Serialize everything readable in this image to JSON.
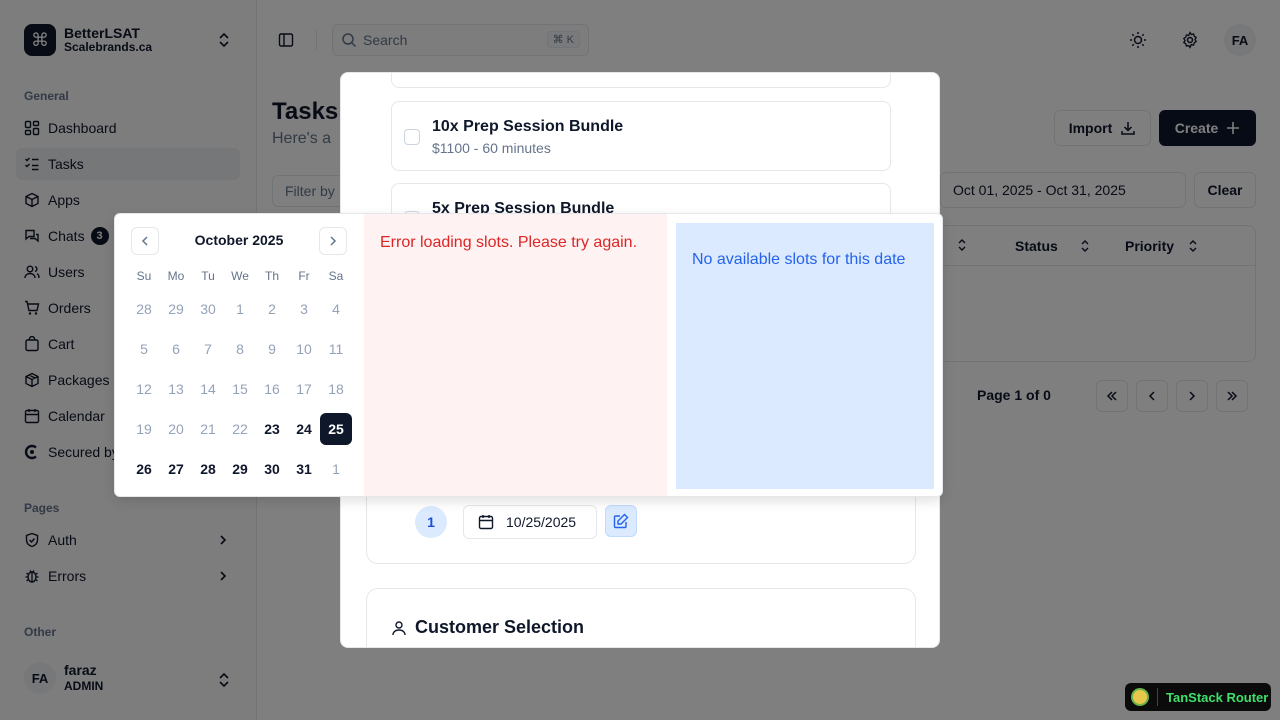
{
  "brand": {
    "name": "BetterLSAT",
    "subtitle": "Scalebrands.ca"
  },
  "sidebar": {
    "general_label": "General",
    "general_items": [
      {
        "label": "Dashboard",
        "icon": "dashboard-icon"
      },
      {
        "label": "Tasks",
        "icon": "tasks-icon",
        "active": true
      },
      {
        "label": "Apps",
        "icon": "apps-icon"
      },
      {
        "label": "Chats",
        "icon": "chats-icon",
        "badge": "3"
      },
      {
        "label": "Users",
        "icon": "users-icon"
      },
      {
        "label": "Orders",
        "icon": "cart-icon"
      },
      {
        "label": "Cart",
        "icon": "cart-icon"
      },
      {
        "label": "Packages",
        "icon": "package-icon"
      },
      {
        "label": "Calendar",
        "icon": "calendar-icon"
      },
      {
        "label": "Secured by",
        "icon": "clerk-icon"
      }
    ],
    "pages_label": "Pages",
    "pages_items": [
      {
        "label": "Auth",
        "icon": "shield-icon"
      },
      {
        "label": "Errors",
        "icon": "bug-icon"
      }
    ],
    "other_label": "Other",
    "user": {
      "initials": "FA",
      "name": "faraz",
      "role": "ADMIN"
    }
  },
  "header": {
    "search_placeholder": "Search",
    "search_shortcut": "⌘ K",
    "avatar_initials": "FA"
  },
  "page": {
    "title": "Tasks",
    "subtitle": "Here's a",
    "import_label": "Import",
    "create_label": "Create",
    "filter_placeholder": "Filter by",
    "date_range": "Oct 01, 2025 - Oct 31, 2025",
    "clear_label": "Clear",
    "columns": [
      "Status",
      "Priority"
    ],
    "pager_text": "Page 1 of 0"
  },
  "modal": {
    "packages": [
      {
        "name": "10x Prep Session Bundle",
        "meta": "$1100 - 60 minutes"
      },
      {
        "name": "5x Prep Session Bundle",
        "meta": ""
      }
    ],
    "session_number": "1",
    "session_date": "10/25/2025",
    "customer_title": "Customer Selection"
  },
  "calendar": {
    "month_label": "October 2025",
    "weekdays": [
      "Su",
      "Mo",
      "Tu",
      "We",
      "Th",
      "Fr",
      "Sa"
    ],
    "weeks": [
      [
        {
          "d": "28",
          "s": "muted"
        },
        {
          "d": "29",
          "s": "muted"
        },
        {
          "d": "30",
          "s": "muted"
        },
        {
          "d": "1",
          "s": "muted"
        },
        {
          "d": "2",
          "s": "muted"
        },
        {
          "d": "3",
          "s": "muted"
        },
        {
          "d": "4",
          "s": "muted"
        }
      ],
      [
        {
          "d": "5",
          "s": "muted"
        },
        {
          "d": "6",
          "s": "muted"
        },
        {
          "d": "7",
          "s": "muted"
        },
        {
          "d": "8",
          "s": "muted"
        },
        {
          "d": "9",
          "s": "muted"
        },
        {
          "d": "10",
          "s": "muted"
        },
        {
          "d": "11",
          "s": "muted"
        }
      ],
      [
        {
          "d": "12",
          "s": "muted"
        },
        {
          "d": "13",
          "s": "muted"
        },
        {
          "d": "14",
          "s": "muted"
        },
        {
          "d": "15",
          "s": "muted"
        },
        {
          "d": "16",
          "s": "muted"
        },
        {
          "d": "17",
          "s": "muted"
        },
        {
          "d": "18",
          "s": "muted"
        }
      ],
      [
        {
          "d": "19",
          "s": "muted"
        },
        {
          "d": "20",
          "s": "muted"
        },
        {
          "d": "21",
          "s": "muted"
        },
        {
          "d": "22",
          "s": "muted"
        },
        {
          "d": "23",
          "s": "avail"
        },
        {
          "d": "24",
          "s": "avail"
        },
        {
          "d": "25",
          "s": "selected"
        }
      ],
      [
        {
          "d": "26",
          "s": "avail"
        },
        {
          "d": "27",
          "s": "avail"
        },
        {
          "d": "28",
          "s": "avail"
        },
        {
          "d": "29",
          "s": "avail"
        },
        {
          "d": "30",
          "s": "avail"
        },
        {
          "d": "31",
          "s": "avail"
        },
        {
          "d": "1",
          "s": "muted"
        }
      ]
    ],
    "error_text": "Error loading slots. Please try again.",
    "no_slots_text": "No available slots for this date"
  },
  "devtools": {
    "label": "TanStack Router"
  },
  "colors": {
    "primary": "#0f172a",
    "error": "#dc2626",
    "info": "#2563eb",
    "error_bg": "#fef2f2",
    "info_bg": "#dbeafe"
  }
}
